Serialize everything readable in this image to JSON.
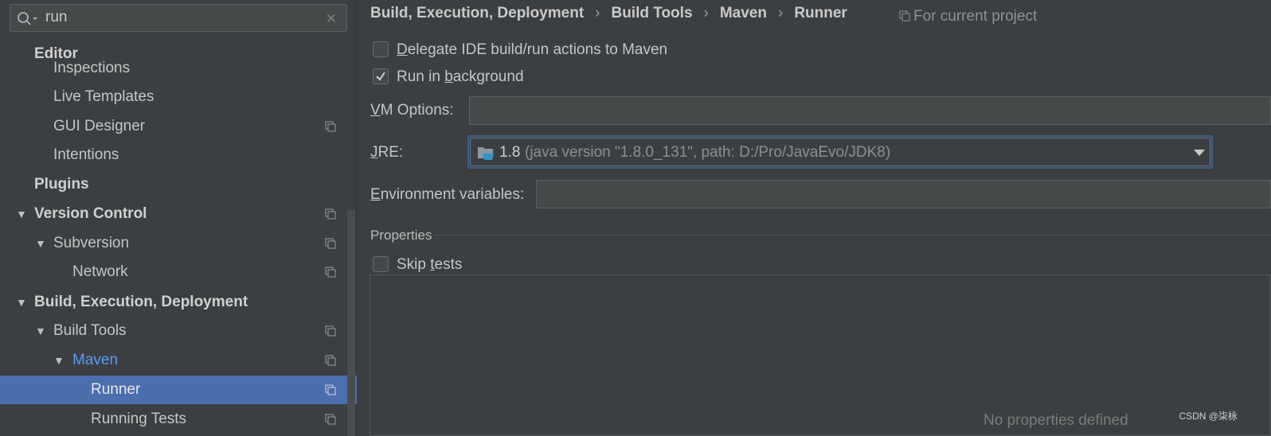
{
  "search": {
    "value": "run"
  },
  "sidebar": {
    "items": [
      {
        "label": "Editor",
        "bold": true
      },
      {
        "label": "Inspections"
      },
      {
        "label": "Live Templates"
      },
      {
        "label": "GUI Designer"
      },
      {
        "label": "Intentions"
      },
      {
        "label": "Plugins",
        "bold": true
      },
      {
        "label": "Version Control",
        "bold": true,
        "expanded": true
      },
      {
        "label": "Subversion",
        "expanded": true
      },
      {
        "label": "Network"
      },
      {
        "label": "Build, Execution, Deployment",
        "bold": true,
        "expanded": true
      },
      {
        "label": "Build Tools",
        "expanded": true
      },
      {
        "label": "Maven",
        "expanded": true,
        "highlighted": true
      },
      {
        "label": "Runner",
        "selected": true
      },
      {
        "label": "Running Tests"
      }
    ]
  },
  "breadcrumb": [
    "Build, Execution, Deployment",
    "Build Tools",
    "Maven",
    "Runner"
  ],
  "scope_label": "For current project",
  "runner": {
    "delegate": {
      "pre": "",
      "mnemonic": "D",
      "post": "elegate IDE build/run actions to Maven",
      "checked": false
    },
    "background": {
      "pre": "Run in ",
      "mnemonic": "b",
      "post": "ackground",
      "checked": true
    },
    "vm_options": {
      "mnemonic": "V",
      "label_rest": "M Options:",
      "value": ""
    },
    "jre": {
      "mnemonic": "J",
      "label_rest": "RE:",
      "version": "1.8",
      "detail": "(java version \"1.8.0_131\", path: D:/Pro/JavaEvo/JDK8)"
    },
    "env": {
      "mnemonic": "E",
      "label_rest": "nvironment variables:",
      "value": ""
    },
    "properties_title": "Properties",
    "skip_tests": {
      "pre": "Skip ",
      "mnemonic": "t",
      "post": "ests",
      "checked": false
    },
    "no_properties": "No properties defined"
  },
  "watermark": "CSDN @柒栐"
}
